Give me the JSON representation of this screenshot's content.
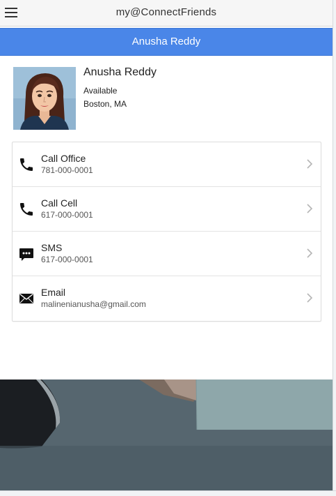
{
  "app": {
    "title": "my@ConnectFriends"
  },
  "contact_bar": {
    "title": "Anusha Reddy"
  },
  "profile": {
    "name": "Anusha Reddy",
    "status": "Available",
    "location": "Boston, MA"
  },
  "contacts": [
    {
      "label": "Call Office",
      "value": "781-000-0001",
      "icon": "phone-icon"
    },
    {
      "label": "Call Cell",
      "value": "617-000-0001",
      "icon": "phone-icon"
    },
    {
      "label": "SMS",
      "value": "617-000-0001",
      "icon": "sms-icon"
    },
    {
      "label": "Email",
      "value": "malinenianusha@gmail.com",
      "icon": "email-icon"
    }
  ],
  "colors": {
    "header_bar": "#4a86e8",
    "topbar": "#f6f6f6"
  }
}
